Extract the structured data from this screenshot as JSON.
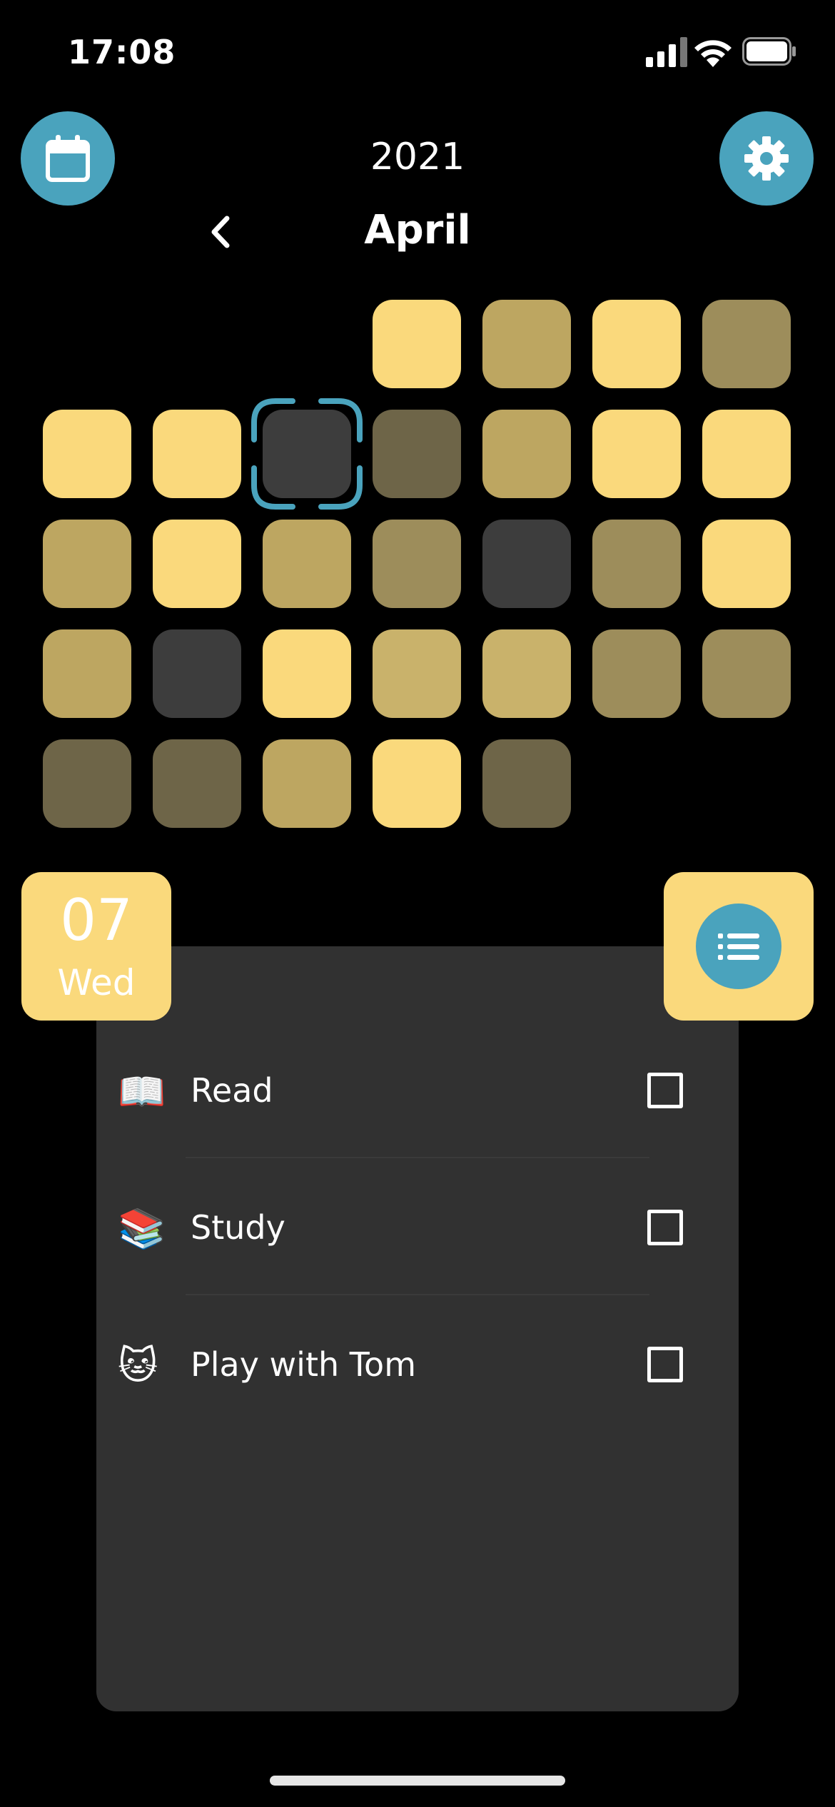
{
  "status_bar": {
    "time": "17:08"
  },
  "header": {
    "year": "2021",
    "month": "April",
    "calendar_icon": "calendar-icon",
    "settings_icon": "gear-icon",
    "prev_icon": "chevron-left-icon"
  },
  "calendar": {
    "selected_day": 7,
    "colors": {
      "full": "#fad97c",
      "high": "#c9b26b",
      "mid": "#bda661",
      "medium": "#9d8d5b",
      "low": "#6e6548",
      "none": "#3d3d3d",
      "selection_frame": "#4aa3bd"
    },
    "days": [
      {
        "day": 1,
        "level": "full"
      },
      {
        "day": 2,
        "level": "mid"
      },
      {
        "day": 3,
        "level": "full"
      },
      {
        "day": 4,
        "level": "medium"
      },
      {
        "day": 5,
        "level": "full"
      },
      {
        "day": 6,
        "level": "full"
      },
      {
        "day": 7,
        "level": "none"
      },
      {
        "day": 8,
        "level": "low"
      },
      {
        "day": 9,
        "level": "mid"
      },
      {
        "day": 10,
        "level": "full"
      },
      {
        "day": 11,
        "level": "full"
      },
      {
        "day": 12,
        "level": "mid"
      },
      {
        "day": 13,
        "level": "full"
      },
      {
        "day": 14,
        "level": "mid"
      },
      {
        "day": 15,
        "level": "medium"
      },
      {
        "day": 16,
        "level": "none"
      },
      {
        "day": 17,
        "level": "medium"
      },
      {
        "day": 18,
        "level": "full"
      },
      {
        "day": 19,
        "level": "mid"
      },
      {
        "day": 20,
        "level": "none"
      },
      {
        "day": 21,
        "level": "full"
      },
      {
        "day": 22,
        "level": "high"
      },
      {
        "day": 23,
        "level": "high"
      },
      {
        "day": 24,
        "level": "medium"
      },
      {
        "day": 25,
        "level": "medium"
      },
      {
        "day": 26,
        "level": "low"
      },
      {
        "day": 27,
        "level": "low"
      },
      {
        "day": 28,
        "level": "mid"
      },
      {
        "day": 29,
        "level": "full"
      },
      {
        "day": 30,
        "level": "low"
      }
    ],
    "first_weekday_index": 3
  },
  "date_card": {
    "day_number": "07",
    "weekday": "Wed"
  },
  "list_button": {
    "icon": "list-icon"
  },
  "tasks": [
    {
      "emoji": "📖",
      "label": "Read",
      "checked": false
    },
    {
      "emoji": "📚",
      "label": "Study",
      "checked": false
    },
    {
      "emoji": "🐱",
      "label": "Play with Tom",
      "checked": false
    }
  ]
}
